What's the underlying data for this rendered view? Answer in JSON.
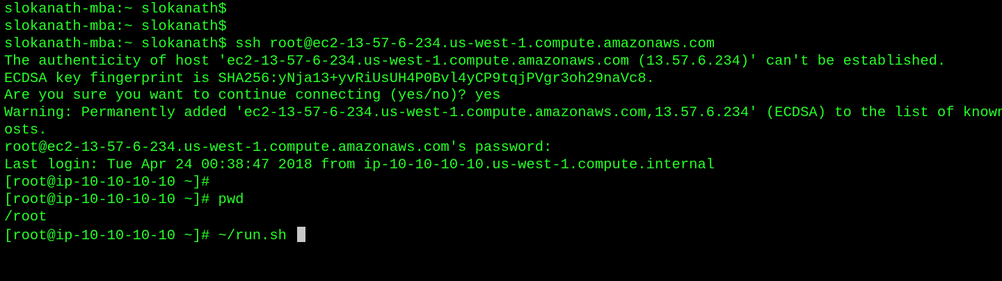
{
  "terminal": {
    "colors": {
      "background": "#000000",
      "foreground": "#26ff26",
      "cursor": "#c8c8c8"
    },
    "lines": [
      "slokanath-mba:~ slokanath$",
      "slokanath-mba:~ slokanath$",
      "slokanath-mba:~ slokanath$ ssh root@ec2-13-57-6-234.us-west-1.compute.amazonaws.com",
      "The authenticity of host 'ec2-13-57-6-234.us-west-1.compute.amazonaws.com (13.57.6.234)' can't be established.",
      "ECDSA key fingerprint is SHA256:yNja13+yvRiUsUH4P0Bvl4yCP9tqjPVgr3oh29naVc8.",
      "Are you sure you want to continue connecting (yes/no)? yes",
      "Warning: Permanently added 'ec2-13-57-6-234.us-west-1.compute.amazonaws.com,13.57.6.234' (ECDSA) to the list of known h",
      "osts.",
      "root@ec2-13-57-6-234.us-west-1.compute.amazonaws.com's password:",
      "Last login: Tue Apr 24 00:38:47 2018 from ip-10-10-10-10.us-west-1.compute.internal",
      "[root@ip-10-10-10-10 ~]#",
      "[root@ip-10-10-10-10 ~]# pwd",
      "/root"
    ],
    "current_prompt": "[root@ip-10-10-10-10 ~]# ~/run.sh "
  }
}
